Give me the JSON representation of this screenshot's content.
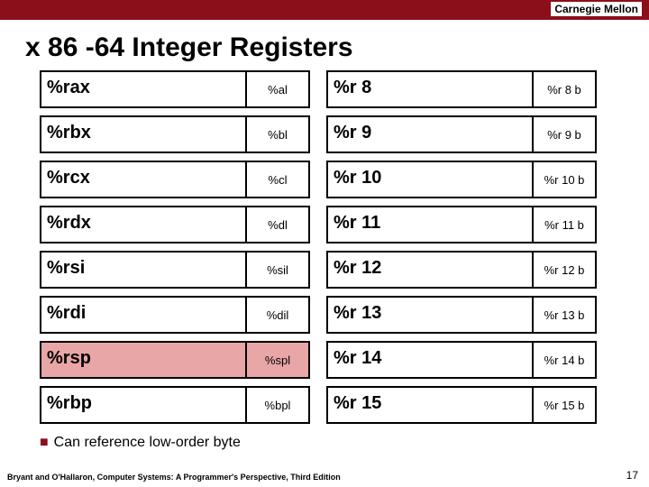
{
  "header": {
    "institution": "Carnegie Mellon"
  },
  "title": "x 86 -64 Integer Registers",
  "registers": {
    "left": [
      {
        "name": "%rax",
        "sub": "%al",
        "highlight": false
      },
      {
        "name": "%rbx",
        "sub": "%bl",
        "highlight": false
      },
      {
        "name": "%rcx",
        "sub": "%cl",
        "highlight": false
      },
      {
        "name": "%rdx",
        "sub": "%dl",
        "highlight": false
      },
      {
        "name": "%rsi",
        "sub": "%sil",
        "highlight": false
      },
      {
        "name": "%rdi",
        "sub": "%dil",
        "highlight": false
      },
      {
        "name": "%rsp",
        "sub": "%spl",
        "highlight": true
      },
      {
        "name": "%rbp",
        "sub": "%bpl",
        "highlight": false
      }
    ],
    "right": [
      {
        "name": "%r 8",
        "sub": "%r 8 b"
      },
      {
        "name": "%r 9",
        "sub": "%r 9 b"
      },
      {
        "name": "%r 10",
        "sub": "%r 10 b"
      },
      {
        "name": "%r 11",
        "sub": "%r 11 b"
      },
      {
        "name": "%r 12",
        "sub": "%r 12 b"
      },
      {
        "name": "%r 13",
        "sub": "%r 13 b"
      },
      {
        "name": "%r 14",
        "sub": "%r 14 b"
      },
      {
        "name": "%r 15",
        "sub": "%r 15 b"
      }
    ]
  },
  "bullet": "Can reference low-order byte",
  "footer": {
    "book": "Bryant and O'Hallaron, Computer Systems: A Programmer's Perspective, Third Edition",
    "page": "17"
  }
}
